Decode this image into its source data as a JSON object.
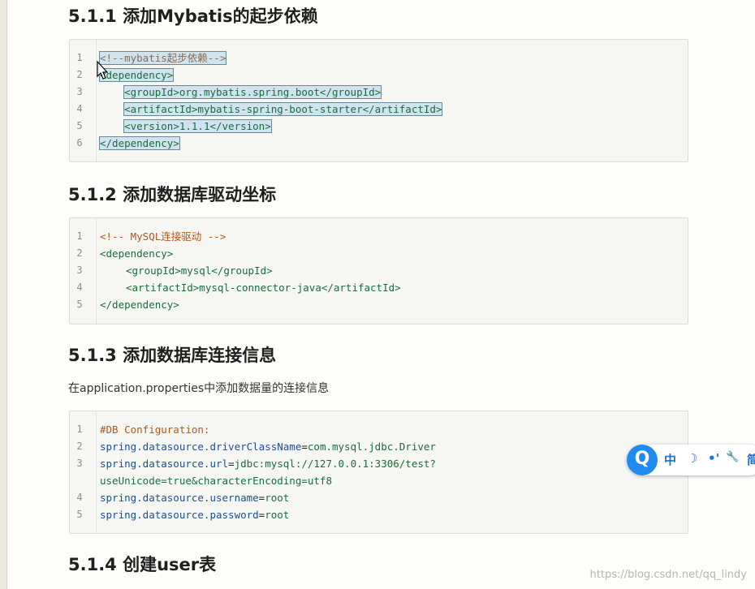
{
  "sections": [
    {
      "heading": "5.1.1 添加Mybatis的起步依赖"
    },
    {
      "heading": "5.1.2 添加数据库驱动坐标"
    },
    {
      "heading": "5.1.3 添加数据库连接信息",
      "description": "在application.properties中添加数据量的连接信息"
    },
    {
      "heading": "5.1.4 创建user表"
    }
  ],
  "code_blocks": [
    {
      "lines": [
        {
          "no": "1",
          "text": "<!--mybatis起步依赖-->"
        },
        {
          "no": "2",
          "text": "<dependency>"
        },
        {
          "no": "3",
          "text": "<groupId>org.mybatis.spring.boot</groupId>"
        },
        {
          "no": "4",
          "text": "<artifactId>mybatis-spring-boot-starter</artifactId>"
        },
        {
          "no": "5",
          "text": "<version>1.1.1</version>"
        },
        {
          "no": "6",
          "text": "</dependency>"
        }
      ]
    },
    {
      "lines": [
        {
          "no": "1",
          "text": "<!-- MySQL连接驱动 -->"
        },
        {
          "no": "2",
          "text": "<dependency>"
        },
        {
          "no": "3",
          "text": "<groupId>mysql</groupId>"
        },
        {
          "no": "4",
          "text": "<artifactId>mysql-connector-java</artifactId>"
        },
        {
          "no": "5",
          "text": "</dependency>"
        }
      ]
    },
    {
      "lines": [
        {
          "no": "1",
          "text": "#DB Configuration:"
        },
        {
          "no": "2",
          "key": "spring.datasource.driverClassName",
          "eq": "=",
          "value": "com.mysql.jdbc.Driver"
        },
        {
          "no": "3",
          "key": "spring.datasource.url",
          "eq": "=",
          "value": "jdbc:mysql://127.0.0.1:3306/test?"
        },
        {
          "no": "",
          "value": "useUnicode=true&characterEncoding=utf8"
        },
        {
          "no": "4",
          "key": "spring.datasource.username",
          "eq": "=",
          "value": "root"
        },
        {
          "no": "5",
          "key": "spring.datasource.password",
          "eq": "=",
          "value": "root"
        }
      ]
    }
  ],
  "toolbar": {
    "logo": "Q",
    "lang": "中",
    "moon_icon": "☽",
    "dots_icon": "•'",
    "wrench_icon": "🔧",
    "more_icon": "简"
  },
  "watermark": "https://blog.csdn.net/qq_lindy",
  "colors": {
    "tag": "#1c6b3f",
    "comment": "#b3561c",
    "property": "#1d4f8f",
    "selection": "#cfe4ef",
    "toolbar_blue": "#1f8af2"
  }
}
